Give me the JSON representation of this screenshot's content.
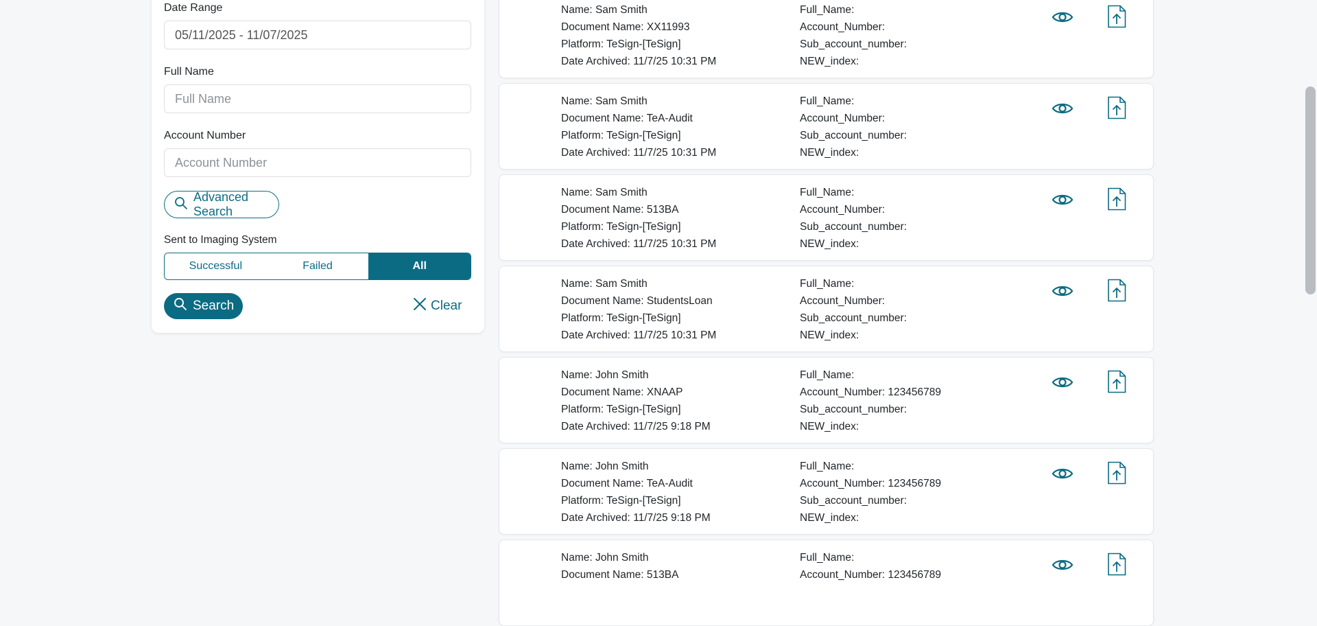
{
  "filters": {
    "date_range_label": "Date Range",
    "date_range_value": "05/11/2025 - 11/07/2025",
    "full_name_label": "Full Name",
    "full_name_placeholder": "Full Name",
    "account_number_label": "Account Number",
    "account_number_placeholder": "Account Number",
    "advanced_search_label": "Advanced Search",
    "sent_label": "Sent to Imaging System",
    "segments": [
      "Successful",
      "Failed",
      "All"
    ],
    "selected_segment": "All",
    "search_label": "Search",
    "clear_label": "Clear"
  },
  "colors": {
    "accent": "#0b6b82",
    "background": "#f6f7f9"
  },
  "icons": {
    "view": "eye-icon",
    "upload": "file-upload-icon",
    "search": "search-icon",
    "clear": "close-icon"
  },
  "results": [
    {
      "name": "Name: Sam Smith",
      "document": "Document Name: XX11993",
      "platform": "Platform: TeSign-[TeSign]",
      "archived": "Date Archived: 11/7/25 10:31 PM",
      "full_name": "Full_Name:",
      "account_number": "Account_Number:",
      "sub_account": "Sub_account_number:",
      "new_index": "NEW_index:"
    },
    {
      "name": "Name: Sam Smith",
      "document": "Document Name: TeA-Audit",
      "platform": "Platform: TeSign-[TeSign]",
      "archived": "Date Archived: 11/7/25 10:31 PM",
      "full_name": "Full_Name:",
      "account_number": "Account_Number:",
      "sub_account": "Sub_account_number:",
      "new_index": "NEW_index:"
    },
    {
      "name": "Name: Sam Smith",
      "document": "Document Name: 513BA",
      "platform": "Platform: TeSign-[TeSign]",
      "archived": "Date Archived: 11/7/25 10:31 PM",
      "full_name": "Full_Name:",
      "account_number": "Account_Number:",
      "sub_account": "Sub_account_number:",
      "new_index": "NEW_index:"
    },
    {
      "name": "Name: Sam Smith",
      "document": "Document Name: StudentsLoan",
      "platform": "Platform: TeSign-[TeSign]",
      "archived": "Date Archived: 11/7/25 10:31 PM",
      "full_name": "Full_Name:",
      "account_number": "Account_Number:",
      "sub_account": "Sub_account_number:",
      "new_index": "NEW_index:"
    },
    {
      "name": "Name: John Smith",
      "document": "Document Name: XNAAP",
      "platform": "Platform: TeSign-[TeSign]",
      "archived": "Date Archived: 11/7/25 9:18 PM",
      "full_name": "Full_Name:",
      "account_number": "Account_Number: 123456789",
      "sub_account": "Sub_account_number:",
      "new_index": "NEW_index:"
    },
    {
      "name": "Name: John Smith",
      "document": "Document Name: TeA-Audit",
      "platform": "Platform: TeSign-[TeSign]",
      "archived": "Date Archived: 11/7/25 9:18 PM",
      "full_name": "Full_Name:",
      "account_number": "Account_Number: 123456789",
      "sub_account": "Sub_account_number:",
      "new_index": "NEW_index:"
    },
    {
      "name": "Name: John Smith",
      "document": "Document Name: 513BA",
      "platform": "",
      "archived": "",
      "full_name": "Full_Name:",
      "account_number": "Account_Number: 123456789",
      "sub_account": "",
      "new_index": ""
    }
  ]
}
